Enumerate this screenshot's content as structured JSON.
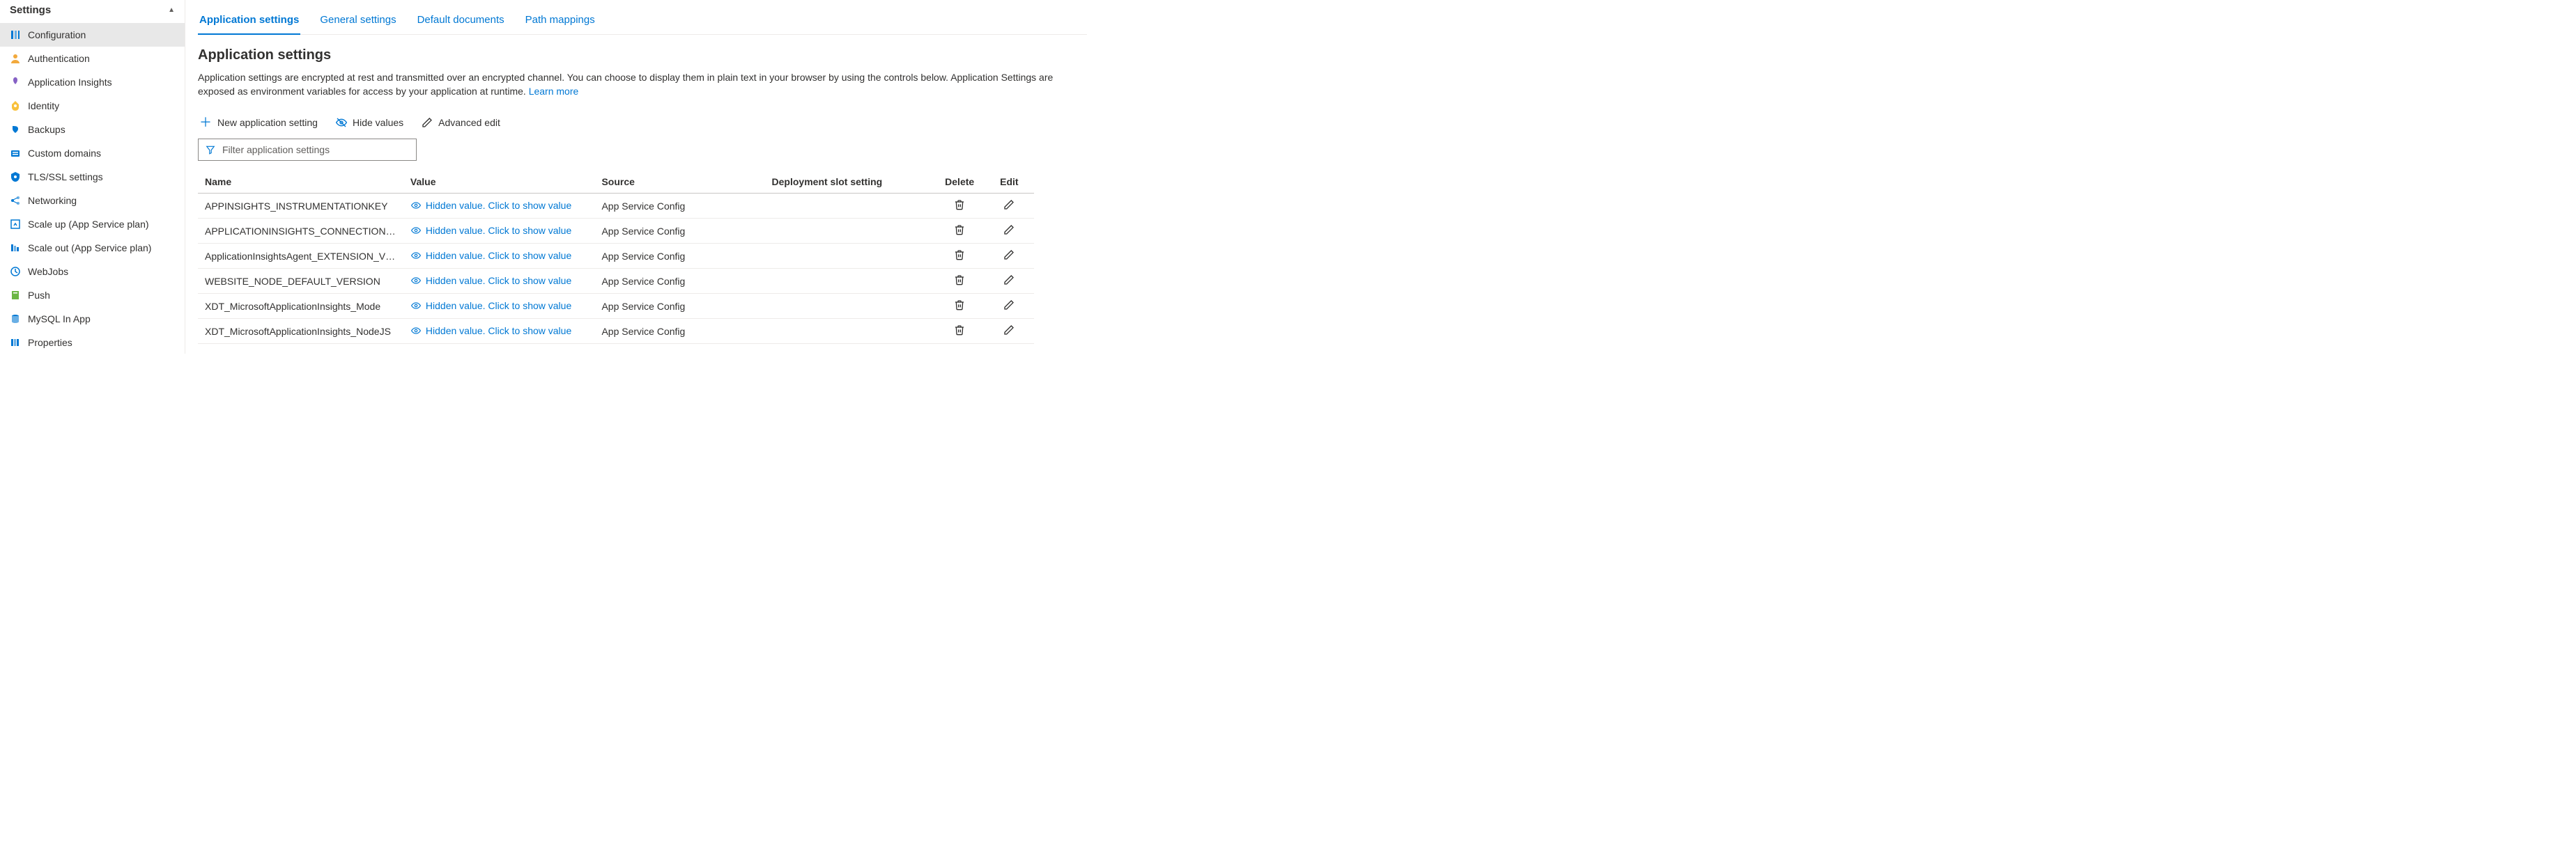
{
  "sidebar": {
    "header": "Settings",
    "items": [
      {
        "label": "Configuration",
        "active": true
      },
      {
        "label": "Authentication"
      },
      {
        "label": "Application Insights"
      },
      {
        "label": "Identity"
      },
      {
        "label": "Backups"
      },
      {
        "label": "Custom domains"
      },
      {
        "label": "TLS/SSL settings"
      },
      {
        "label": "Networking"
      },
      {
        "label": "Scale up (App Service plan)"
      },
      {
        "label": "Scale out (App Service plan)"
      },
      {
        "label": "WebJobs"
      },
      {
        "label": "Push"
      },
      {
        "label": "MySQL In App"
      },
      {
        "label": "Properties"
      }
    ]
  },
  "tabs": [
    {
      "label": "Application settings",
      "active": true
    },
    {
      "label": "General settings"
    },
    {
      "label": "Default documents"
    },
    {
      "label": "Path mappings"
    }
  ],
  "section": {
    "title": "Application settings",
    "desc_a": "Application settings are encrypted at rest and transmitted over an encrypted channel. You can choose to display them in plain text in your browser by using the controls below. Application Settings are exposed as environment variables for access by your application at runtime. ",
    "learn_more": "Learn more"
  },
  "toolbar": {
    "new": "New application setting",
    "hide": "Hide values",
    "advanced": "Advanced edit"
  },
  "filter": {
    "placeholder": "Filter application settings"
  },
  "table": {
    "headers": {
      "name": "Name",
      "value": "Value",
      "source": "Source",
      "slot": "Deployment slot setting",
      "delete": "Delete",
      "edit": "Edit"
    },
    "hidden_text": "Hidden value. Click to show value",
    "rows": [
      {
        "name": "APPINSIGHTS_INSTRUMENTATIONKEY",
        "source": "App Service Config"
      },
      {
        "name": "APPLICATIONINSIGHTS_CONNECTION_STRING",
        "source": "App Service Config"
      },
      {
        "name": "ApplicationInsightsAgent_EXTENSION_VERSION",
        "source": "App Service Config"
      },
      {
        "name": "WEBSITE_NODE_DEFAULT_VERSION",
        "source": "App Service Config"
      },
      {
        "name": "XDT_MicrosoftApplicationInsights_Mode",
        "source": "App Service Config"
      },
      {
        "name": "XDT_MicrosoftApplicationInsights_NodeJS",
        "source": "App Service Config"
      }
    ]
  }
}
